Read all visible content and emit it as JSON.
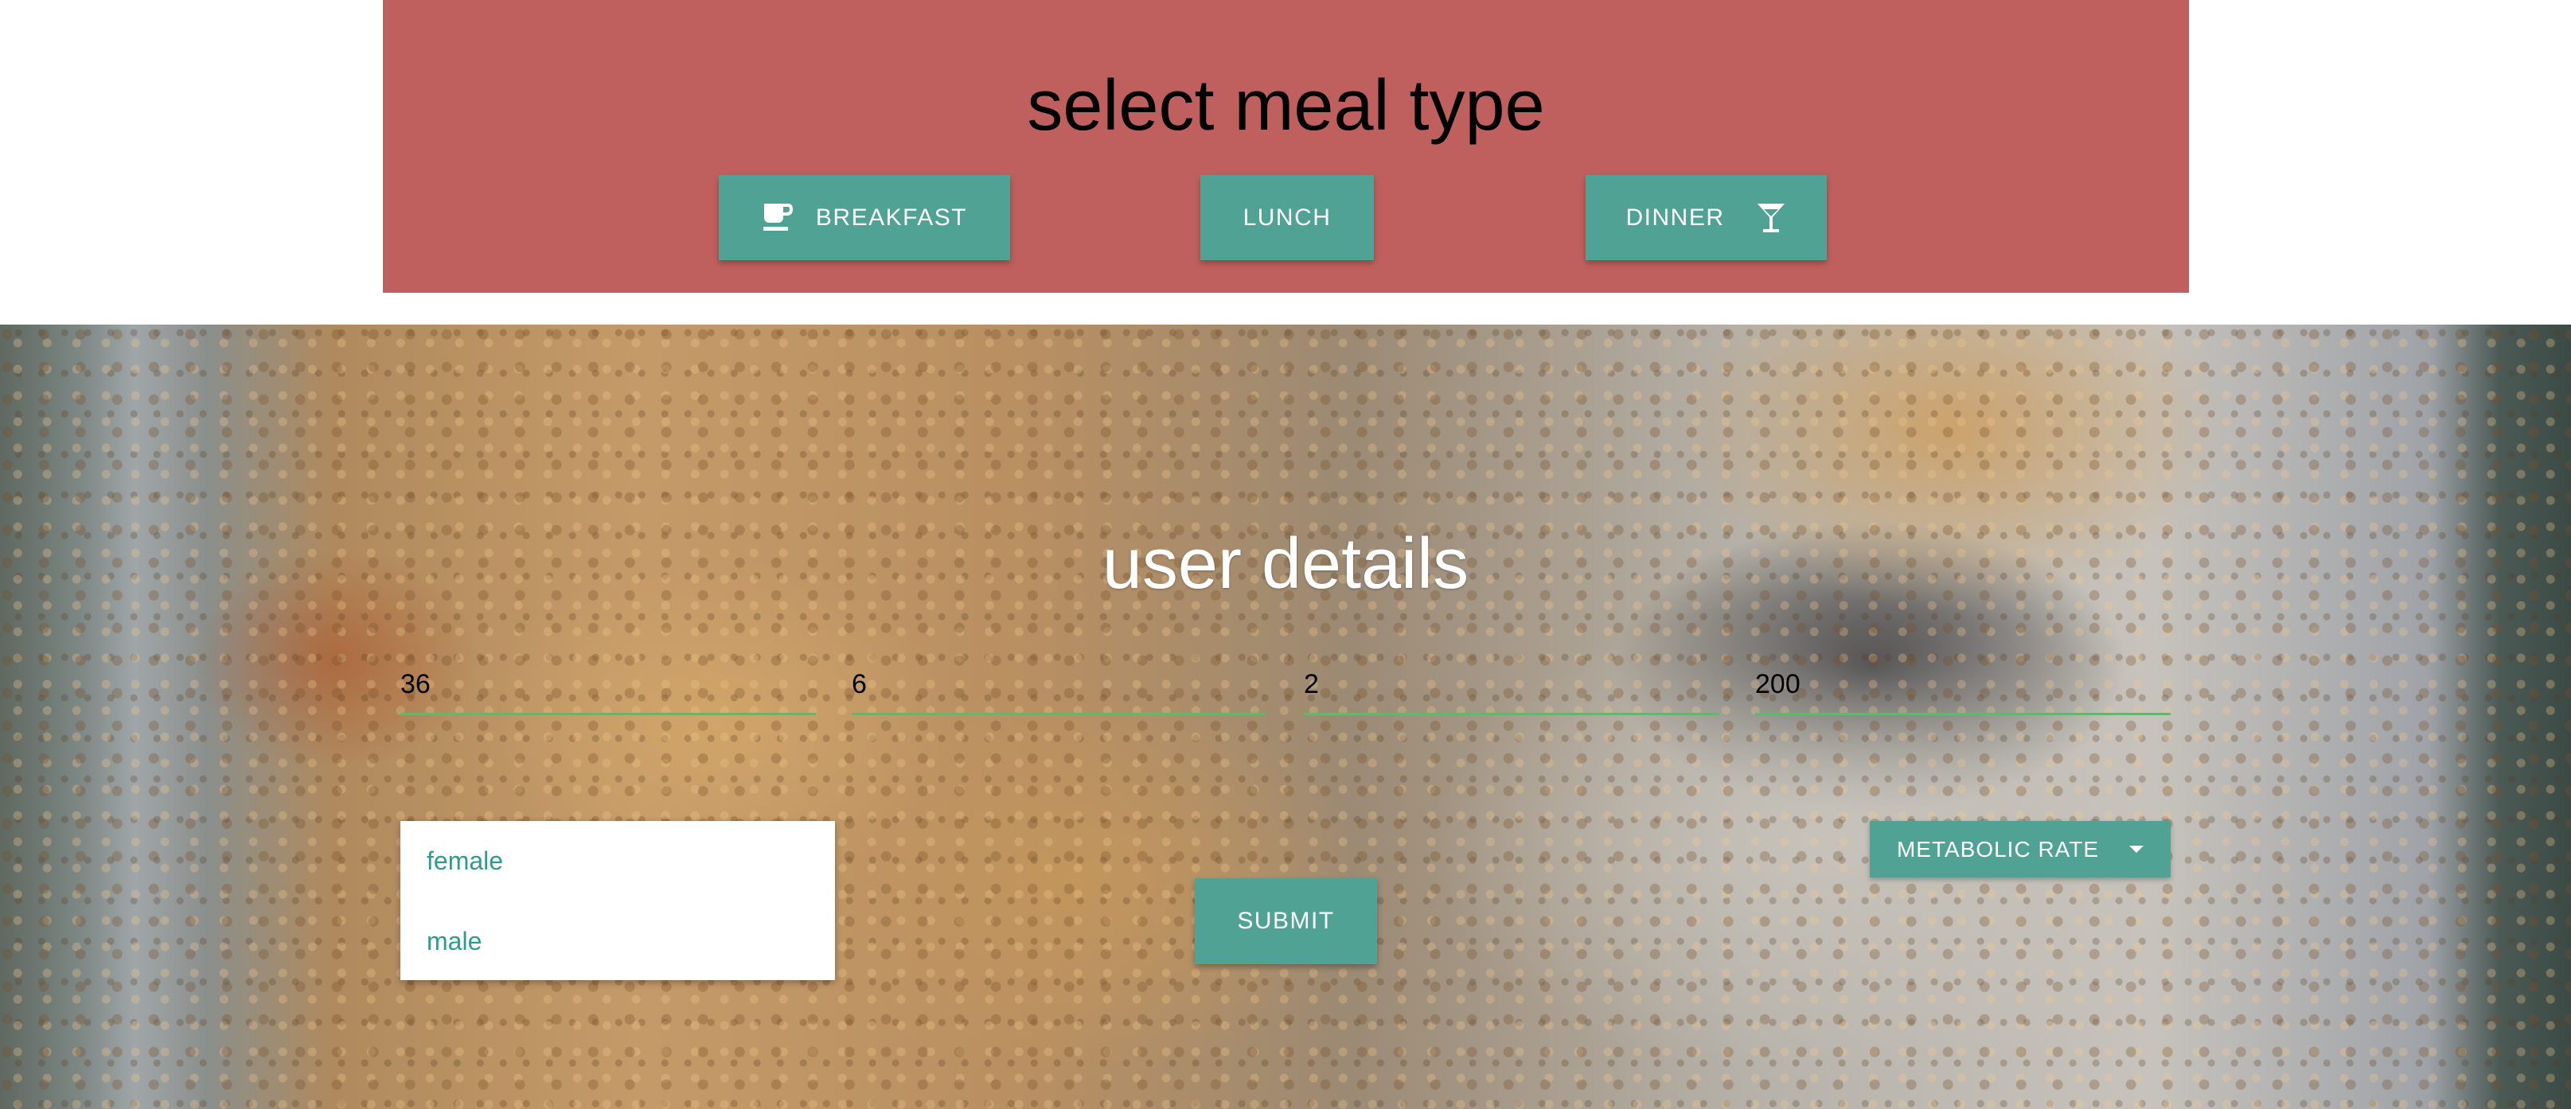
{
  "meal_section": {
    "title": "select meal type",
    "buttons": [
      {
        "label": "BREAKFAST",
        "icon": "coffee-cup-icon"
      },
      {
        "label": "LUNCH"
      },
      {
        "label": "DINNER",
        "icon": "cocktail-glass-icon"
      }
    ]
  },
  "user_section": {
    "title": "user details",
    "fields": [
      {
        "value": "36"
      },
      {
        "value": "6"
      },
      {
        "value": "2"
      },
      {
        "value": "200"
      }
    ],
    "gender_options": [
      "female",
      "male"
    ],
    "submit_label": "SUBMIT",
    "metabolic_rate_label": "METABOLIC RATE",
    "metabolic_rate_icon": "caret-down-icon"
  },
  "colors": {
    "panel": "#c0605e",
    "button": "#4fa294",
    "field_underline": "#6bb36a",
    "option_text": "#2e9d8e"
  }
}
